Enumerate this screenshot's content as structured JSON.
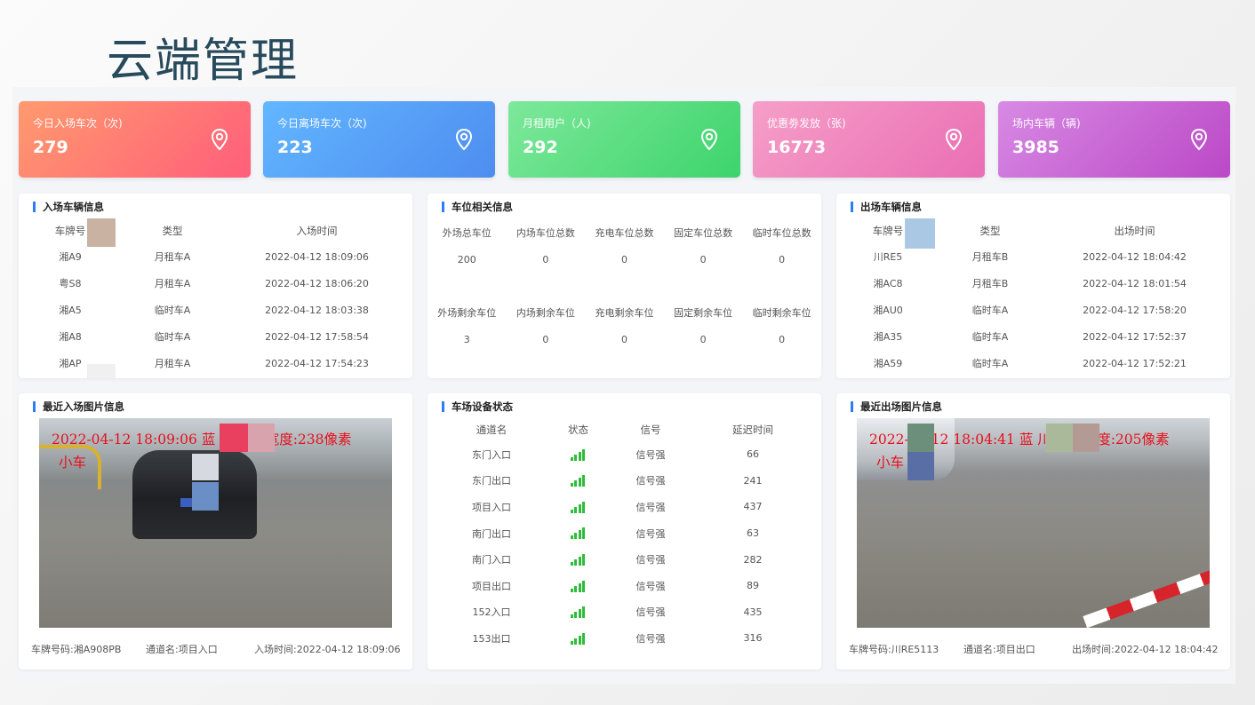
{
  "title": "云端管理",
  "stats": [
    {
      "label": "今日入场车次（次)",
      "value": "279",
      "icon": "location-pin-icon"
    },
    {
      "label": "今日离场车次（次)",
      "value": "223",
      "icon": "location-pin-icon"
    },
    {
      "label": "月租用户（人)",
      "value": "292",
      "icon": "location-pin-icon"
    },
    {
      "label": "优惠劵发放（张)",
      "value": "16773",
      "icon": "location-pin-icon"
    },
    {
      "label": "场内车辆（辆)",
      "value": "3985",
      "icon": "location-pin-icon"
    }
  ],
  "entry": {
    "title": "入场车辆信息",
    "headers": [
      "车牌号",
      "类型",
      "入场时间"
    ],
    "rows": [
      [
        "湘A9",
        "月租车A",
        "2022-04-12 18:09:06"
      ],
      [
        "粤S8",
        "月租车A",
        "2022-04-12 18:06:20"
      ],
      [
        "湘A5",
        "临时车A",
        "2022-04-12 18:03:38"
      ],
      [
        "湘A8",
        "临时车A",
        "2022-04-12 17:58:54"
      ],
      [
        "湘AP",
        "月租车A",
        "2022-04-12 17:54:23"
      ]
    ]
  },
  "spaces": {
    "title": "车位相关信息",
    "headers1": [
      "外场总车位",
      "内场车位总数",
      "充电车位总数",
      "固定车位总数",
      "临时车位总数"
    ],
    "values1": [
      "200",
      "0",
      "0",
      "0",
      "0"
    ],
    "headers2": [
      "外场剩余车位",
      "内场剩余车位",
      "充电剩余车位",
      "固定剩余车位",
      "临时剩余车位"
    ],
    "values2": [
      "3",
      "0",
      "0",
      "0",
      "0"
    ]
  },
  "exit": {
    "title": "出场车辆信息",
    "headers": [
      "车牌号",
      "类型",
      "出场时间"
    ],
    "rows": [
      [
        "川RE5",
        "月租车B",
        "2022-04-12 18:04:42"
      ],
      [
        "湘AC8",
        "月租车B",
        "2022-04-12 18:01:54"
      ],
      [
        "湘AU0",
        "临时车A",
        "2022-04-12 17:58:20"
      ],
      [
        "湘A35",
        "临时车A",
        "2022-04-12 17:52:37"
      ],
      [
        "湘A59",
        "临时车A",
        "2022-04-12 17:52:21"
      ]
    ]
  },
  "entry_photo": {
    "title": "最近入场图片信息",
    "overlay_line1": "2022-04-12 18:09:06 蓝 湘 车牌宽度:238像素",
    "overlay_line2": "小车",
    "plate": "车牌号码:湘A908PB",
    "channel": "通道名:项目入口",
    "time": "入场时间:2022-04-12 18:09:06"
  },
  "devices": {
    "title": "车场设备状态",
    "headers": [
      "通道名",
      "状态",
      "信号",
      "延迟时间"
    ],
    "rows": [
      [
        "东门入口",
        "信号强",
        "66"
      ],
      [
        "东门出口",
        "信号强",
        "241"
      ],
      [
        "项目入口",
        "信号强",
        "437"
      ],
      [
        "南门出口",
        "信号强",
        "63"
      ],
      [
        "南门入口",
        "信号强",
        "282"
      ],
      [
        "项目出口",
        "信号强",
        "89"
      ],
      [
        "152入口",
        "信号强",
        "435"
      ],
      [
        "153出口",
        "信号强",
        "316"
      ]
    ],
    "signal_color": "#2dbd3a"
  },
  "exit_photo": {
    "title": "最近出场图片信息",
    "overlay_line1": "2022-04-12 18:04:41 蓝 川 车牌宽度:205像素",
    "overlay_line2": "小车",
    "plate": "车牌号码:川RE5113",
    "channel": "通道名:项目出口",
    "time": "出场时间:2022-04-12 18:04:42"
  }
}
